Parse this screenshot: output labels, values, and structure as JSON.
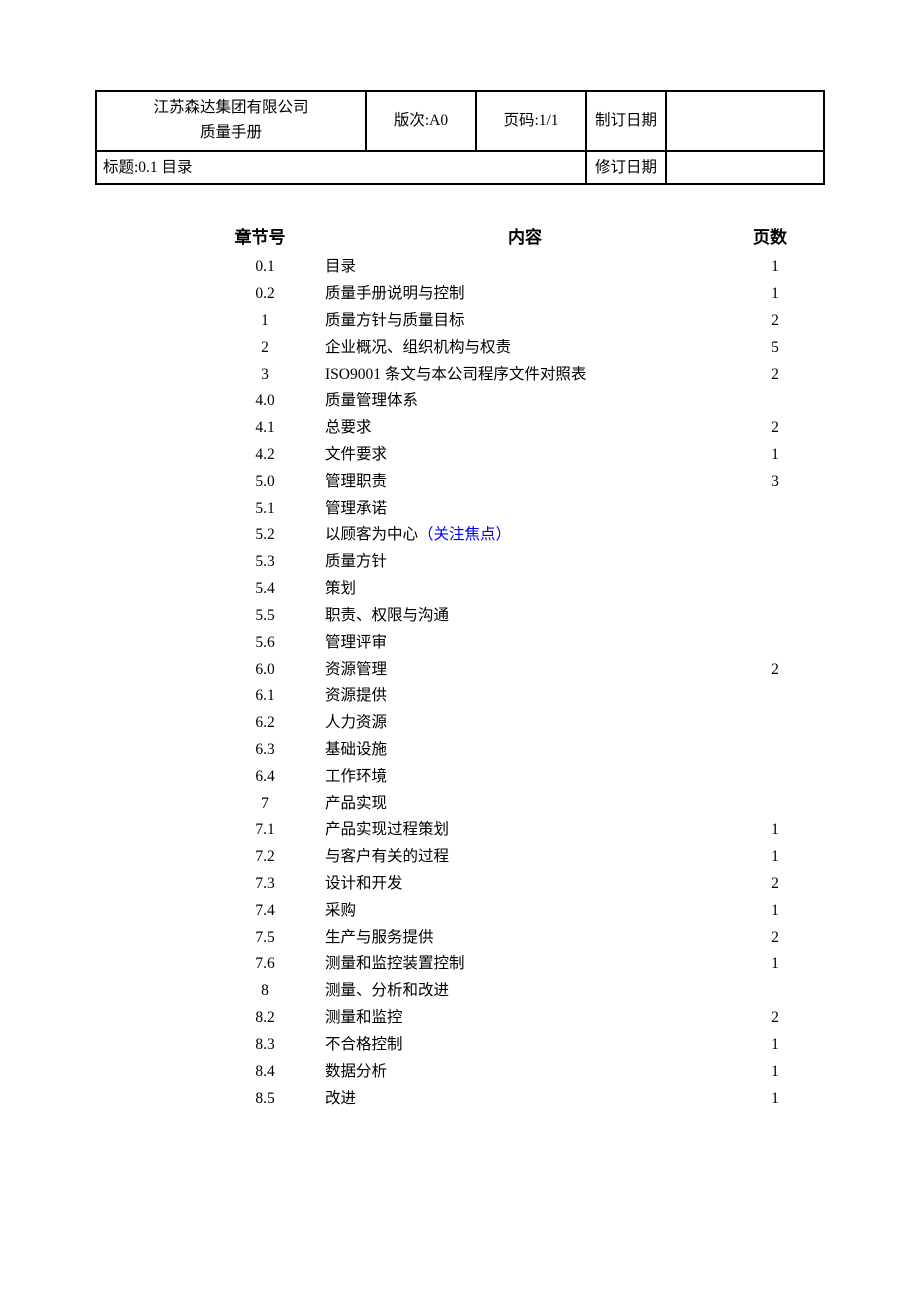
{
  "header": {
    "company_line1": "江苏森达集团有限公司",
    "company_line2": "质量手册",
    "version_label": "版次:A0",
    "page_label": "页码:1/1",
    "create_date_label": "制订日期",
    "create_date_value": "",
    "title_label": "标题:0.1 目录",
    "revise_date_label": "修订日期",
    "revise_date_value": ""
  },
  "toc_headers": {
    "chapter": "章节号",
    "content": "内容",
    "pages": "页数"
  },
  "toc": [
    {
      "chap": "0.1",
      "content": "目录",
      "page": "1"
    },
    {
      "chap": "0.2",
      "content": "质量手册说明与控制",
      "page": "1"
    },
    {
      "chap": "1",
      "content": "质量方针与质量目标",
      "page": "2"
    },
    {
      "chap": "2",
      "content": "企业概况、组织机构与权责",
      "page": "5"
    },
    {
      "chap": "3",
      "content": "ISO9001 条文与本公司程序文件对照表",
      "page": "2"
    },
    {
      "chap": "4.0",
      "content": "质量管理体系",
      "page": ""
    },
    {
      "chap": "4.1",
      "content": "总要求",
      "page": "2"
    },
    {
      "chap": "4.2",
      "content": "文件要求",
      "page": "1"
    },
    {
      "chap": "5.0",
      "content": "管理职责",
      "page": "3"
    },
    {
      "chap": "5.1",
      "content": "管理承诺",
      "page": ""
    },
    {
      "chap": "5.2",
      "content": "以顾客为中心",
      "content_suffix": "（关注焦点）",
      "page": ""
    },
    {
      "chap": "5.3",
      "content": "质量方针",
      "page": ""
    },
    {
      "chap": "5.4",
      "content": "策划",
      "page": ""
    },
    {
      "chap": "5.5",
      "content": "职责、权限与沟通",
      "page": ""
    },
    {
      "chap": "5.6",
      "content": "管理评审",
      "page": ""
    },
    {
      "chap": "6.0",
      "content": "资源管理",
      "page": "2"
    },
    {
      "chap": "6.1",
      "content": "资源提供",
      "page": ""
    },
    {
      "chap": "6.2",
      "content": "人力资源",
      "page": ""
    },
    {
      "chap": "6.3",
      "content": "基础设施",
      "page": ""
    },
    {
      "chap": "6.4",
      "content": "工作环境",
      "page": ""
    },
    {
      "chap": "7",
      "content": "产品实现",
      "page": ""
    },
    {
      "chap": "7.1",
      "content": "产品实现过程策划",
      "page": "1"
    },
    {
      "chap": "7.2",
      "content": "与客户有关的过程",
      "page": "1"
    },
    {
      "chap": "7.3",
      "content": "设计和开发",
      "page": "2"
    },
    {
      "chap": "7.4",
      "content": "采购",
      "page": "1"
    },
    {
      "chap": "7.5",
      "content": "生产与服务提供",
      "page": "2"
    },
    {
      "chap": "7.6",
      "content": "测量和监控装置控制",
      "page": "1"
    },
    {
      "chap": "8",
      "content": "测量、分析和改进",
      "page": ""
    },
    {
      "chap": "8.2",
      "content": "测量和监控",
      "page": "2"
    },
    {
      "chap": "8.3",
      "content": "不合格控制",
      "page": "1"
    },
    {
      "chap": "8.4",
      "content": "数据分析",
      "page": "1"
    },
    {
      "chap": "8.5",
      "content": "改进",
      "page": "1"
    }
  ]
}
